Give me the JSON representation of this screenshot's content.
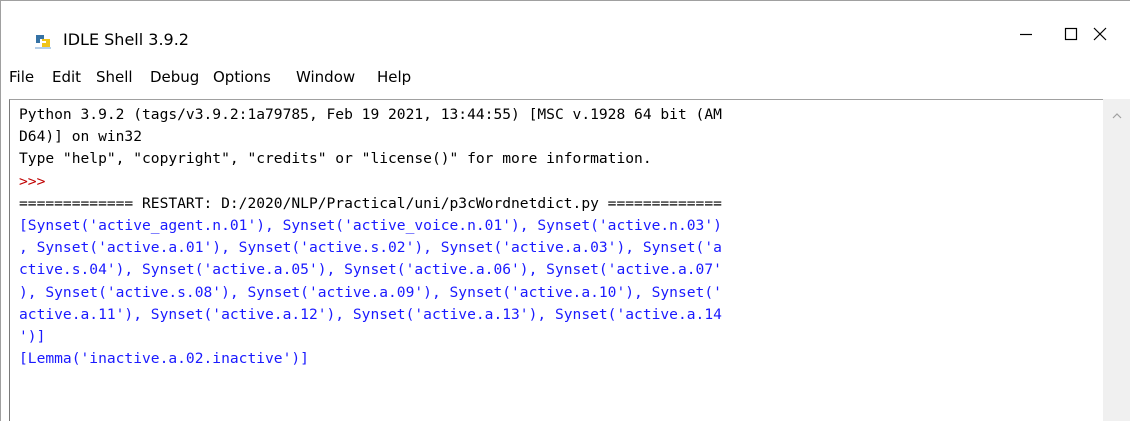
{
  "window": {
    "title": "IDLE Shell 3.9.2",
    "icons": {
      "app": "python-idle-icon",
      "minimize": "minimize-icon",
      "maximize": "maximize-icon",
      "close": "close-icon",
      "scroll_up": "chevron-up-icon"
    }
  },
  "menu": {
    "items": [
      "File",
      "Edit",
      "Shell",
      "Debug",
      "Options",
      "Window",
      "Help"
    ]
  },
  "shell": {
    "lines": [
      {
        "text": "Python 3.9.2 (tags/v3.9.2:1a79785, Feb 19 2021, 13:44:55) [MSC v.1928 64 bit (AM",
        "kind": "plain"
      },
      {
        "text": "D64)] on win32",
        "kind": "plain"
      },
      {
        "text": "Type \"help\", \"copyright\", \"credits\" or \"license()\" for more information.",
        "kind": "plain"
      },
      {
        "text": ">>>",
        "kind": "prompt"
      },
      {
        "text": "============= RESTART: D:/2020/NLP/Practical/uni/p3cWordnetdict.py =============",
        "kind": "plain"
      },
      {
        "text": "[Synset('active_agent.n.01'), Synset('active_voice.n.01'), Synset('active.n.03')",
        "kind": "output"
      },
      {
        "text": ", Synset('active.a.01'), Synset('active.s.02'), Synset('active.a.03'), Synset('a",
        "kind": "output"
      },
      {
        "text": "ctive.s.04'), Synset('active.a.05'), Synset('active.a.06'), Synset('active.a.07'",
        "kind": "output"
      },
      {
        "text": "), Synset('active.s.08'), Synset('active.a.09'), Synset('active.a.10'), Synset('",
        "kind": "output"
      },
      {
        "text": "active.a.11'), Synset('active.a.12'), Synset('active.a.13'), Synset('active.a.14",
        "kind": "output"
      },
      {
        "text": "')]",
        "kind": "output"
      },
      {
        "text": "[Lemma('inactive.a.02.inactive')]",
        "kind": "output"
      }
    ]
  },
  "colors": {
    "prompt": "#c00000",
    "output": "#1a1aff",
    "text": "#000000"
  }
}
